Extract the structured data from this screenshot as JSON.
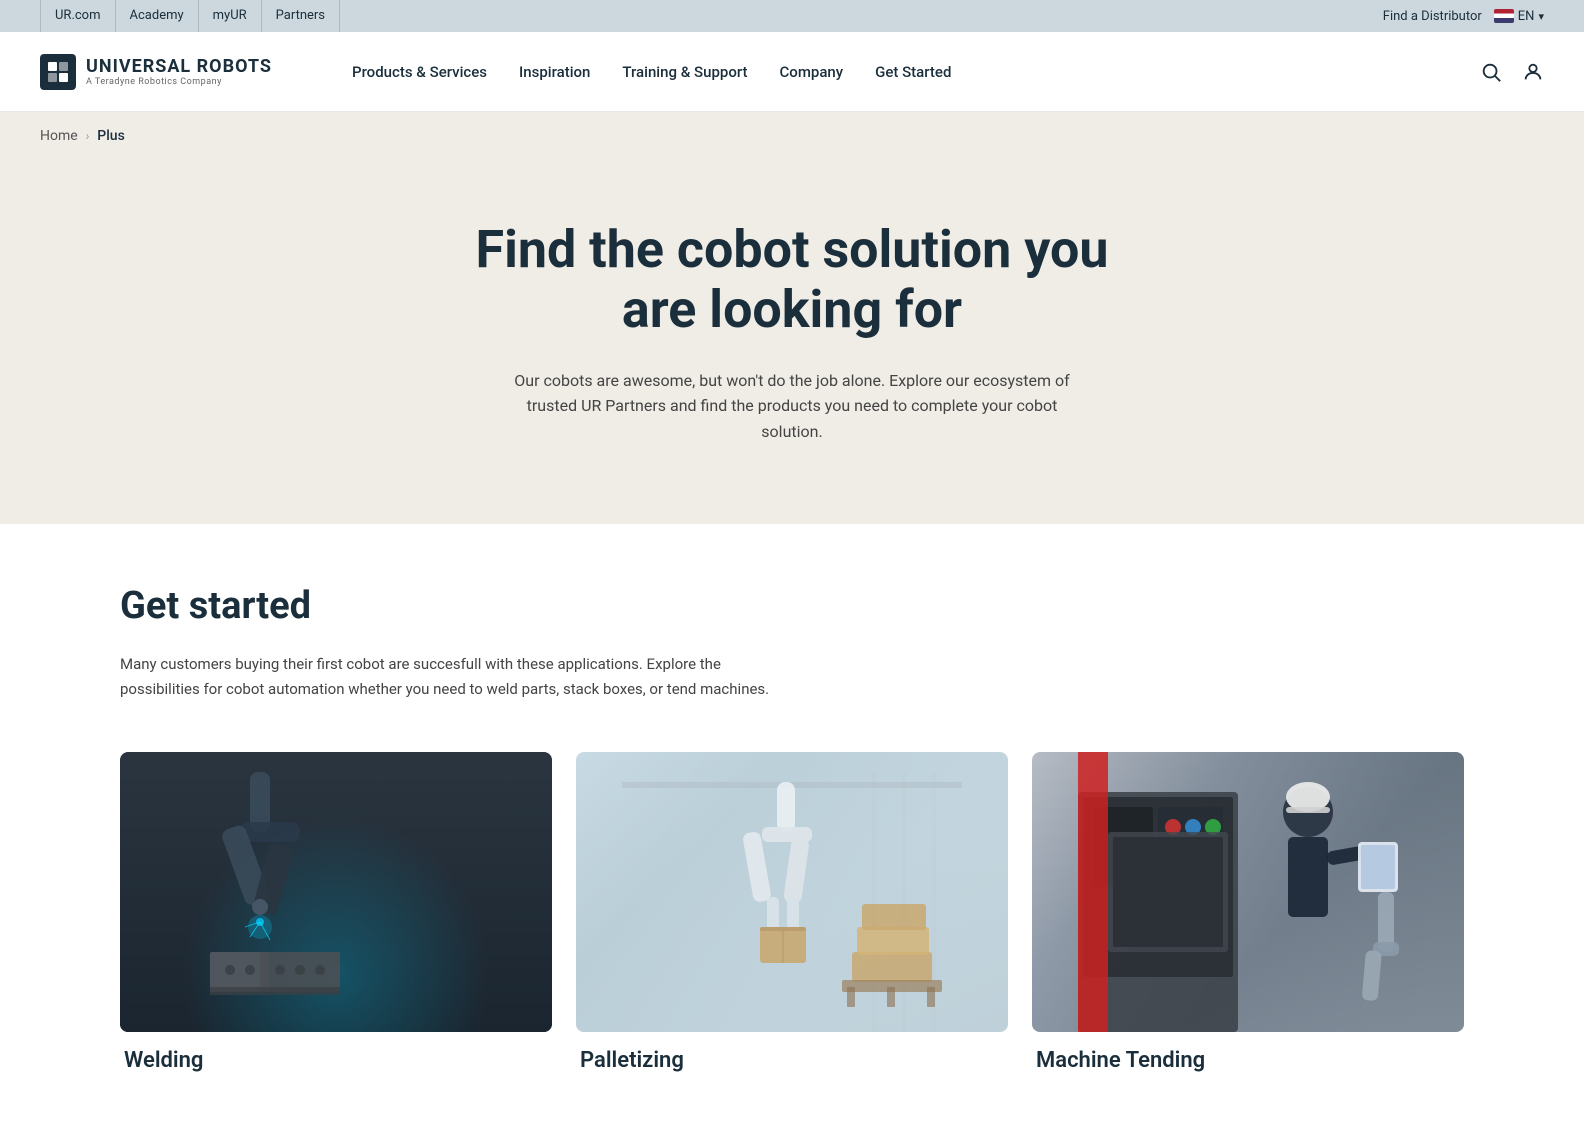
{
  "topbar": {
    "links": [
      "UR.com",
      "Academy",
      "myUR",
      "Partners"
    ],
    "find_distributor": "Find a Distributor",
    "language": "EN"
  },
  "header": {
    "logo_text": "UNIVERSAL ROBOTS",
    "logo_sub": "A Teradyne Robotics Company",
    "logo_icon": "UR",
    "nav": [
      {
        "label": "Products & Services"
      },
      {
        "label": "Inspiration"
      },
      {
        "label": "Training & Support"
      },
      {
        "label": "Company"
      },
      {
        "label": "Get Started"
      }
    ]
  },
  "breadcrumb": {
    "home": "Home",
    "current": "Plus"
  },
  "hero": {
    "title": "Find the cobot solution you are looking for",
    "description": "Our cobots are awesome, but won't do the job alone. Explore our ecosystem of trusted UR Partners and find the products you need to complete your cobot solution."
  },
  "main": {
    "section_title": "Get started",
    "section_desc": "Many customers buying their first cobot are succesfull with these applications. Explore the possibilities for cobot automation whether you need to weld parts, stack boxes, or tend machines.",
    "cards": [
      {
        "label": "Welding",
        "type": "welding"
      },
      {
        "label": "Palletizing",
        "type": "palletizing"
      },
      {
        "label": "Machine Tending",
        "type": "machine"
      }
    ]
  }
}
